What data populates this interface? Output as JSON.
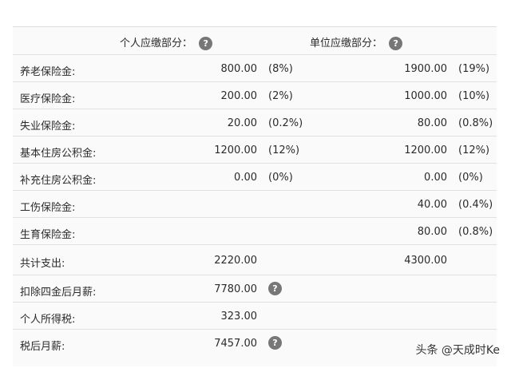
{
  "header": {
    "personal": "个人应缴部分：",
    "company": "单位应缴部分："
  },
  "insurance_rows": [
    {
      "label": "养老保险金:",
      "personal_value": "800.00",
      "personal_pct": "(8%)",
      "company_value": "1900.00",
      "company_pct": "(19%)"
    },
    {
      "label": "医疗保险金:",
      "personal_value": "200.00",
      "personal_pct": "(2%)",
      "company_value": "1000.00",
      "company_pct": "(10%)"
    },
    {
      "label": "失业保险金:",
      "personal_value": "20.00",
      "personal_pct": "(0.2%)",
      "company_value": "80.00",
      "company_pct": "(0.8%)"
    },
    {
      "label": "基本住房公积金:",
      "personal_value": "1200.00",
      "personal_pct": "(12%)",
      "company_value": "1200.00",
      "company_pct": "(12%)"
    },
    {
      "label": "补充住房公积金:",
      "personal_value": "0.00",
      "personal_pct": "(0%)",
      "company_value": "0.00",
      "company_pct": "(0%)"
    },
    {
      "label": "工伤保险金:",
      "personal_value": "",
      "personal_pct": "",
      "company_value": "40.00",
      "company_pct": "(0.4%)"
    },
    {
      "label": "生育保险金:",
      "personal_value": "",
      "personal_pct": "",
      "company_value": "80.00",
      "company_pct": "(0.8%)"
    }
  ],
  "totals": {
    "label": "共计支出:",
    "personal": "2220.00",
    "company": "4300.00"
  },
  "after_deduction": {
    "label": "扣除四金后月薪:",
    "value": "7780.00"
  },
  "income_tax": {
    "label": "个人所得税:",
    "value": "323.00"
  },
  "net_salary": {
    "label": "税后月薪:",
    "value": "7457.00"
  },
  "help_icon_glyph": "?",
  "watermark": "头条 @天成时Ke"
}
